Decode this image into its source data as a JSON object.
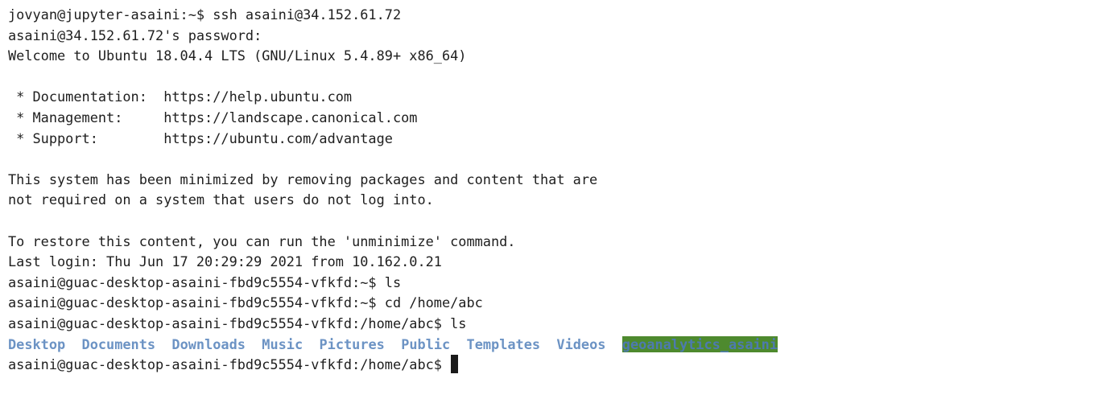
{
  "terminal": {
    "lines": [
      "jovyan@jupyter-asaini:~$ ssh asaini@34.152.61.72",
      "asaini@34.152.61.72's password:",
      "Welcome to Ubuntu 18.04.4 LTS (GNU/Linux 5.4.89+ x86_64)",
      "",
      " * Documentation:  https://help.ubuntu.com",
      " * Management:     https://landscape.canonical.com",
      " * Support:        https://ubuntu.com/advantage",
      "",
      "This system has been minimized by removing packages and content that are",
      "not required on a system that users do not log into.",
      "",
      "To restore this content, you can run the 'unminimize' command.",
      "Last login: Thu Jun 17 20:29:29 2021 from 10.162.0.21",
      "asaini@guac-desktop-asaini-fbd9c5554-vfkfd:~$ ls",
      "asaini@guac-desktop-asaini-fbd9c5554-vfkfd:~$ cd /home/abc",
      "asaini@guac-desktop-asaini-fbd9c5554-vfkfd:/home/abc$ ls"
    ],
    "ls_output": [
      "Desktop",
      "Documents",
      "Downloads",
      "Music",
      "Pictures",
      "Public",
      "Templates",
      "Videos",
      "geoanalytics_asaini"
    ],
    "current_prompt": "asaini@guac-desktop-asaini-fbd9c5554-vfkfd:/home/abc$ ",
    "colors": {
      "text": "#1e1e1e",
      "directory": "#6c93c4",
      "highlighted_directory_bg": "#4e8a2e",
      "background": "#ffffff"
    }
  }
}
